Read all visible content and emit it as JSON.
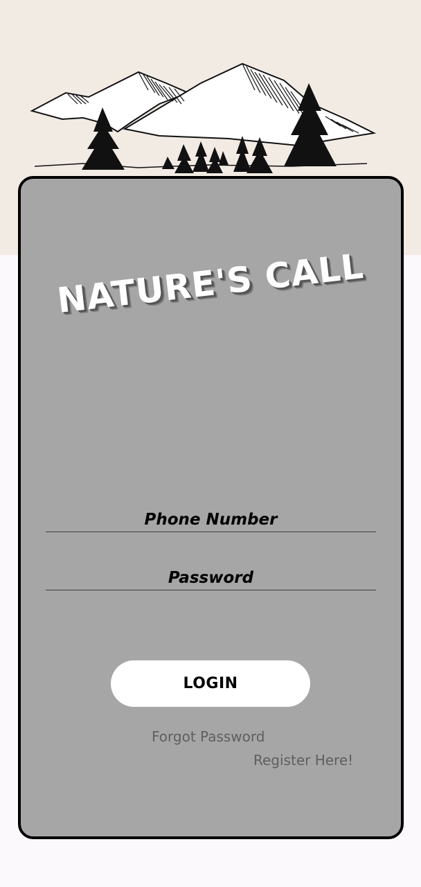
{
  "app": {
    "title": "NATURE'S CALL"
  },
  "hero": {
    "illustration": "mountains-and-pines-sketch"
  },
  "form": {
    "phone_placeholder": "Phone Number",
    "phone_value": "",
    "password_placeholder": "Password",
    "password_value": ""
  },
  "actions": {
    "login_label": "LOGIN",
    "forgot_password_label": "Forgot Password",
    "register_label": "Register Here!"
  },
  "colors": {
    "hero_bg": "#f2ebe4",
    "card_bg": "#a6a6a6",
    "card_border": "#000000",
    "page_bg": "#fcf9fc",
    "link_text": "#5f5f5f"
  }
}
